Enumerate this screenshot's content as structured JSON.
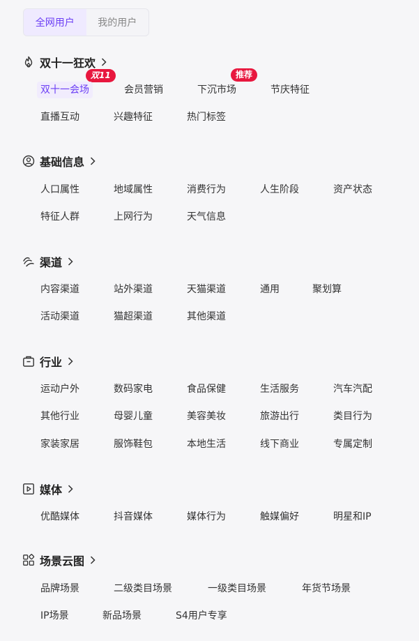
{
  "tabs": [
    {
      "label": "全网用户",
      "active": true
    },
    {
      "label": "我的用户",
      "active": false
    }
  ],
  "accent_color": "#6c3ff5",
  "badge_color": "#e8173e",
  "sections": {
    "double11": {
      "title": "双十一狂欢",
      "icon": "flame-icon",
      "items": [
        "双十一会场",
        "会员营销",
        "下沉市场",
        "节庆特征",
        "直播互动",
        "兴趣特征",
        "热门标签"
      ],
      "badges": {
        "double11": "双11",
        "recommend": "推荐"
      }
    },
    "basic": {
      "title": "基础信息",
      "icon": "user-circle-icon",
      "items": [
        "人口属性",
        "地域属性",
        "消费行为",
        "人生阶段",
        "资产状态",
        "特征人群",
        "上网行为",
        "天气信息"
      ]
    },
    "channel": {
      "title": "渠道",
      "icon": "wave-icon",
      "items": [
        "内容渠道",
        "站外渠道",
        "天猫渠道",
        "通用",
        "聚划算",
        "活动渠道",
        "猫超渠道",
        "其他渠道"
      ]
    },
    "industry": {
      "title": "行业",
      "icon": "briefcase-icon",
      "items": [
        "运动户外",
        "数码家电",
        "食品保健",
        "生活服务",
        "汽车汽配",
        "其他行业",
        "母婴儿童",
        "美容美妆",
        "旅游出行",
        "类目行为",
        "家装家居",
        "服饰鞋包",
        "本地生活",
        "线下商业",
        "专属定制"
      ]
    },
    "media": {
      "title": "媒体",
      "icon": "play-box-icon",
      "items": [
        "优酷媒体",
        "抖音媒体",
        "媒体行为",
        "触媒偏好",
        "明星和IP"
      ]
    },
    "scene": {
      "title": "场景云图",
      "icon": "grid-apps-icon",
      "items": [
        "品牌场景",
        "二级类目场景",
        "一级类目场景",
        "年货节场景",
        "IP场景",
        "新品场景",
        "S4用户专享"
      ]
    }
  }
}
